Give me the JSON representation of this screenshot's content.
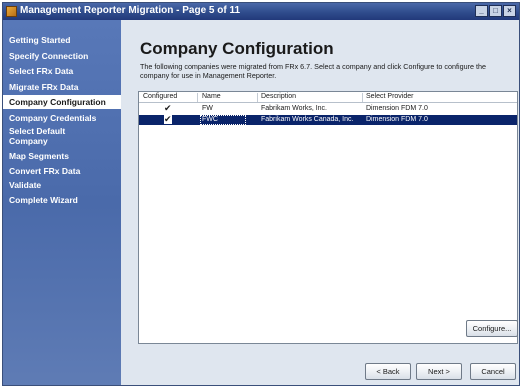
{
  "window": {
    "title": "Management Reporter Migration - Page 5 of 11",
    "controls": {
      "minimize": "_",
      "maximize": "□",
      "close": "×"
    }
  },
  "sidebar": {
    "items": [
      {
        "label": "Getting Started"
      },
      {
        "label": "Specify Connection"
      },
      {
        "label": "Select FRx Data"
      },
      {
        "label": "Migrate FRx Data"
      },
      {
        "label": "Company Configuration",
        "active": true
      },
      {
        "label": "Company Credentials"
      },
      {
        "label": "Select Default Company"
      },
      {
        "label": "Map Segments"
      },
      {
        "label": "Convert FRx Data"
      },
      {
        "label": "Validate"
      },
      {
        "label": "Complete Wizard"
      }
    ]
  },
  "main": {
    "title": "Company Configuration",
    "description": "The following companies were migrated from FRx 6.7.  Select a company and click Configure to configure the company for use in Management Reporter."
  },
  "grid": {
    "columns": [
      "Configured",
      "Name",
      "Description",
      "Select Provider"
    ],
    "rows": [
      {
        "configured": "✔",
        "name": "FW",
        "description": "Fabrikam Works, Inc.",
        "provider": "Dimension FDM 7.0",
        "selected": false
      },
      {
        "configured": "✔",
        "name": "FWC",
        "description": "Fabrikam Works Canada, Inc.",
        "provider": "Dimension FDM 7.0",
        "selected": true
      }
    ]
  },
  "buttons": {
    "configure": "Configure...",
    "back": "< Back",
    "next": "Next >",
    "cancel": "Cancel"
  },
  "colors": {
    "sidebar": "#4a6aaa",
    "titlebar": "#2f4c8c",
    "selection": "#0a246a"
  }
}
